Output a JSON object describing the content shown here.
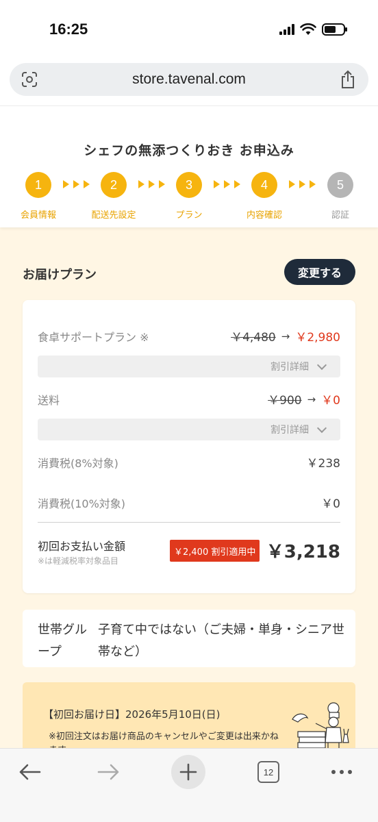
{
  "status_bar": {
    "time": "16:25",
    "battery_level": 0.62
  },
  "browser": {
    "url": "store.tavenal.com",
    "tab_count": "12"
  },
  "header": {
    "title": "シェフの無添つくりおき お申込み",
    "steps": [
      {
        "number": "1",
        "label": "会員情報",
        "state": "done"
      },
      {
        "number": "2",
        "label": "配送先設定",
        "state": "done"
      },
      {
        "number": "3",
        "label": "プラン",
        "state": "done"
      },
      {
        "number": "4",
        "label": "内容確認",
        "state": "current"
      },
      {
        "number": "5",
        "label": "認証",
        "state": "inactive"
      }
    ],
    "accent_color": "#f6b40f"
  },
  "plan_section": {
    "title": "お届けプラン",
    "change_label": "変更する",
    "plan_row": {
      "label": "食卓サポートプラン ※",
      "original": "￥4,480",
      "arrow": "→",
      "discounted": "￥2,980"
    },
    "detail_label": "割引詳細",
    "shipping_row": {
      "label": "送料",
      "original": "￥900",
      "arrow": "→",
      "discounted": "￥0"
    },
    "tax8_row": {
      "label": "消費税(8%対象)",
      "value": "￥238"
    },
    "tax10_row": {
      "label": "消費税(10%対象)",
      "value": "￥0"
    },
    "total": {
      "label": "初回お支払い金額",
      "note": "※は軽減税率対象品目",
      "badge": "￥2,400 割引適用中",
      "amount": "￥3,218"
    },
    "discount_color": "#e0391d"
  },
  "household": {
    "label": "世帯グループ",
    "value": "子育て中ではない（ご夫婦・単身・シニア世帯など）"
  },
  "delivery": {
    "date": "【初回お届け日】2026年5月10日(日)",
    "note": "※初回注文はお届け商品のキャンセルやご変更は出来かねます"
  }
}
